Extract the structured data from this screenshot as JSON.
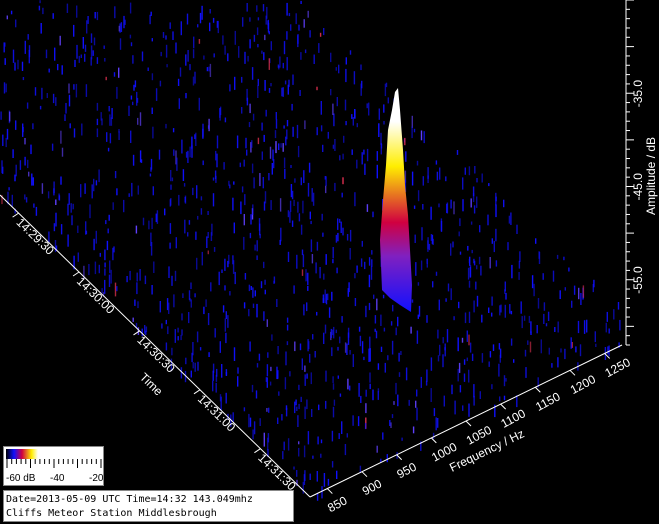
{
  "chart_data": {
    "type": "heatmap",
    "view": "3d-waterfall",
    "frequency_axis": {
      "label": "Frequency / Hz",
      "ticks": [
        850,
        900,
        950,
        1000,
        1050,
        1100,
        1150,
        1200,
        1250
      ],
      "range": [
        825,
        1275
      ]
    },
    "time_axis": {
      "label": "Time",
      "ticks": [
        "14:29:30",
        "14:30:00",
        "14:30:30",
        "14:31:00",
        "14:31:30"
      ]
    },
    "amplitude_axis": {
      "label": "Amplitude / dB",
      "ticks": [
        "-55.0",
        "-45.0",
        "-35.0"
      ],
      "values": [
        -55,
        -45,
        -35
      ],
      "range": [
        -62,
        -25
      ]
    },
    "legend": {
      "labels": [
        "-60 dB",
        "-40",
        "-20"
      ],
      "range": [
        -60,
        -20
      ]
    },
    "colors": {
      "background": "#000000",
      "noise_low": "#1010ff",
      "mid": "#d00040",
      "high": "#ffee00",
      "peak": "#ffffff"
    },
    "meteor_echo": {
      "frequency_hz": 948,
      "time": "14:30:00",
      "peak_db": -25
    }
  },
  "info": {
    "line1": "Date=2013-05-09 UTC Time=14:32 143.049mhz",
    "line2": "Cliffs Meteor Station Middlesbrough"
  }
}
